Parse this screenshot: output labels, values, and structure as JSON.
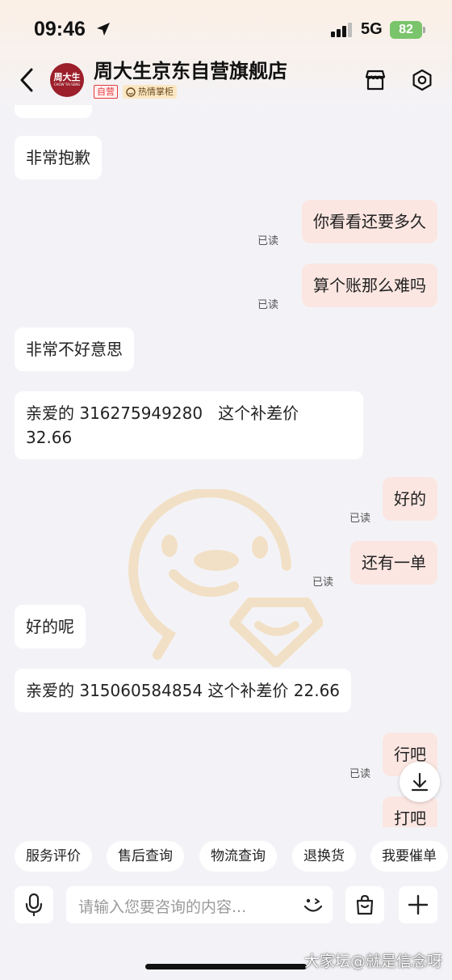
{
  "status_bar": {
    "time": "09:46",
    "network": "5G",
    "battery": "82"
  },
  "header": {
    "shop_name": "周大生京东自营旗舰店",
    "avatar_text": "周大生",
    "avatar_subtext": "CHOW TAI SENG",
    "tag_self": "自营",
    "tag_warm": "热情掌柜"
  },
  "messages": [
    {
      "side": "in",
      "text": "非常抱歉"
    },
    {
      "side": "out",
      "text": "你看看还要多久",
      "status": "已读"
    },
    {
      "side": "out",
      "text": "算个账那么难吗",
      "status": "已读"
    },
    {
      "side": "in",
      "text": "非常不好意思"
    },
    {
      "side": "in",
      "text": "亲爱的 316275949280   这个补差价\n32.66"
    },
    {
      "side": "out",
      "text": "好的",
      "status": "已读"
    },
    {
      "side": "out",
      "text": "还有一单",
      "status": "已读"
    },
    {
      "side": "in",
      "text": "好的呢"
    },
    {
      "side": "in",
      "text": "亲爱的 315060584854 这个补差价 22.66"
    },
    {
      "side": "out",
      "text": "行吧",
      "status": "已读"
    },
    {
      "side": "out",
      "text": "打吧"
    }
  ],
  "quick_actions": [
    "服务评价",
    "售后查询",
    "物流查询",
    "退换货",
    "我要催单"
  ],
  "input": {
    "placeholder": "请输入您要咨询的内容..."
  },
  "credit": "大家坛@就是信念呀",
  "colors": {
    "outgoing_bubble": "#fbe6e1",
    "incoming_bubble": "#ffffff",
    "brand_red": "#9c1f2b",
    "self_tag": "#e4393c"
  },
  "icons": [
    "location-arrow-icon",
    "signal-icon",
    "back-chevron-icon",
    "store-icon",
    "settings-icon",
    "scroll-down-icon",
    "microphone-icon",
    "emoji-icon",
    "shopping-bag-icon",
    "plus-icon",
    "mascot-watermark"
  ]
}
